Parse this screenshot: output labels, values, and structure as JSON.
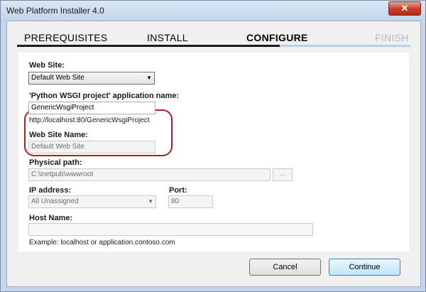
{
  "window": {
    "title": "Web Platform Installer 4.0",
    "close_glyph": "✕"
  },
  "steps": [
    {
      "label": "PREREQUISITES",
      "state": "done"
    },
    {
      "label": "INSTALL",
      "state": "done"
    },
    {
      "label": "CONFIGURE",
      "state": "active"
    },
    {
      "label": "FINISH",
      "state": "pending"
    }
  ],
  "form": {
    "web_site": {
      "label": "Web Site:",
      "value": "Default Web Site"
    },
    "app_name": {
      "label": "'Python WSGI project' application name:",
      "value": "GenericWsgiProject",
      "url": "http://localhost:80/GenericWsgiProject"
    },
    "web_site_name": {
      "label": "Web Site Name:",
      "placeholder": "Default Web Site"
    },
    "physical_path": {
      "label": "Physical path:",
      "value": "C:\\inetpub\\wwwroot",
      "browse": "..."
    },
    "ip_address": {
      "label": "IP address:",
      "value": "All Unassigned"
    },
    "port": {
      "label": "Port:",
      "value": "80"
    },
    "host_name": {
      "label": "Host Name:",
      "value": "",
      "example": "Example: localhost or application.contoso.com"
    }
  },
  "buttons": {
    "cancel": "Cancel",
    "continue": "Continue"
  },
  "colors": {
    "accent": "#1a1a1a",
    "active_bar": "#1b1b1b",
    "pending_bar": "#b7cfe8",
    "highlight": "#b01e2a"
  }
}
